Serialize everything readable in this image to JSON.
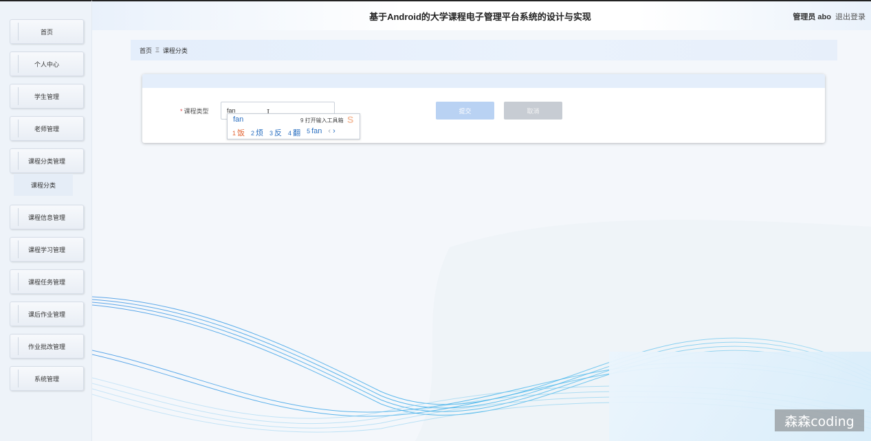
{
  "header": {
    "title": "基于Android的大学课程电子管理平台系统的设计与实现",
    "user_label": "管理员 abo",
    "logout_label": "退出登录"
  },
  "sidebar": {
    "items": [
      {
        "label": "首页"
      },
      {
        "label": "个人中心"
      },
      {
        "label": "学生管理"
      },
      {
        "label": "老师管理"
      },
      {
        "label": "课程分类管理"
      },
      {
        "label": "课程信息管理"
      },
      {
        "label": "课程学习管理"
      },
      {
        "label": "课程任务管理"
      },
      {
        "label": "课后作业管理"
      },
      {
        "label": "作业批改管理"
      },
      {
        "label": "系统管理"
      }
    ],
    "sub_item": "课程分类"
  },
  "breadcrumb": {
    "home": "首页",
    "separator": "Ξ",
    "current": "课程分类"
  },
  "form": {
    "field_label": "课程类型",
    "required_mark": "*",
    "field_value": "fan",
    "submit_label": "提交",
    "cancel_label": "取消"
  },
  "ime": {
    "composition": "fan",
    "toolbox": "9 打开输入工具箱",
    "candidates": [
      {
        "num": "1",
        "text": "饭"
      },
      {
        "num": "2",
        "text": "烦"
      },
      {
        "num": "3",
        "text": "反"
      },
      {
        "num": "4",
        "text": "翻"
      },
      {
        "num": "5",
        "text": "fan"
      }
    ],
    "prev": "‹",
    "next": "›"
  },
  "watermark": "森森coding",
  "colors": {
    "accent_light": "#b9d2f3",
    "header_bg": "#e4eefb",
    "required": "#e04b4b",
    "ime_candidate": "#2a6fc0",
    "ime_first": "#e2612f"
  }
}
